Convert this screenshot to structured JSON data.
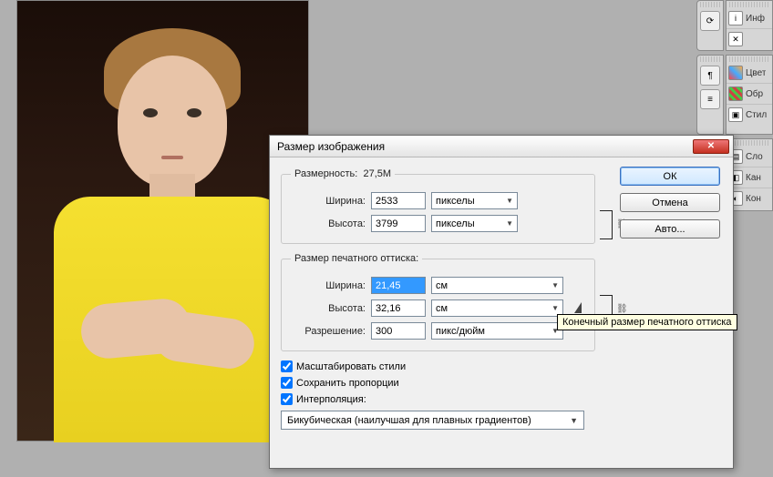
{
  "dialog": {
    "title": "Размер изображения",
    "dimensions_group_label": "Размерность:",
    "dimensions_value": "27,5M",
    "pixel": {
      "width_label": "Ширина:",
      "width_value": "2533",
      "width_unit": "пикселы",
      "height_label": "Высота:",
      "height_value": "3799",
      "height_unit": "пикселы"
    },
    "print_group_label": "Размер печатного оттиска:",
    "print": {
      "width_label": "Ширина:",
      "width_value": "21,45",
      "width_unit": "см",
      "height_label": "Высота:",
      "height_value": "32,16",
      "height_unit": "см",
      "res_label": "Разрешение:",
      "res_value": "300",
      "res_unit": "пикс/дюйм"
    },
    "checks": {
      "scale_styles": "Масштабировать стили",
      "constrain": "Сохранить пропорции",
      "interpolation": "Интерполяция:"
    },
    "interp_method": "Бикубическая (наилучшая для плавных градиентов)",
    "buttons": {
      "ok": "ОК",
      "cancel": "Отмена",
      "auto": "Авто..."
    },
    "tooltip": "Конечный размер печатного оттиска"
  },
  "panels": {
    "info": "Инф",
    "colors": "Цвет",
    "samples": "Обр",
    "styles": "Стил",
    "layers": "Сло",
    "channels": "Кан",
    "contours": "Кон"
  }
}
